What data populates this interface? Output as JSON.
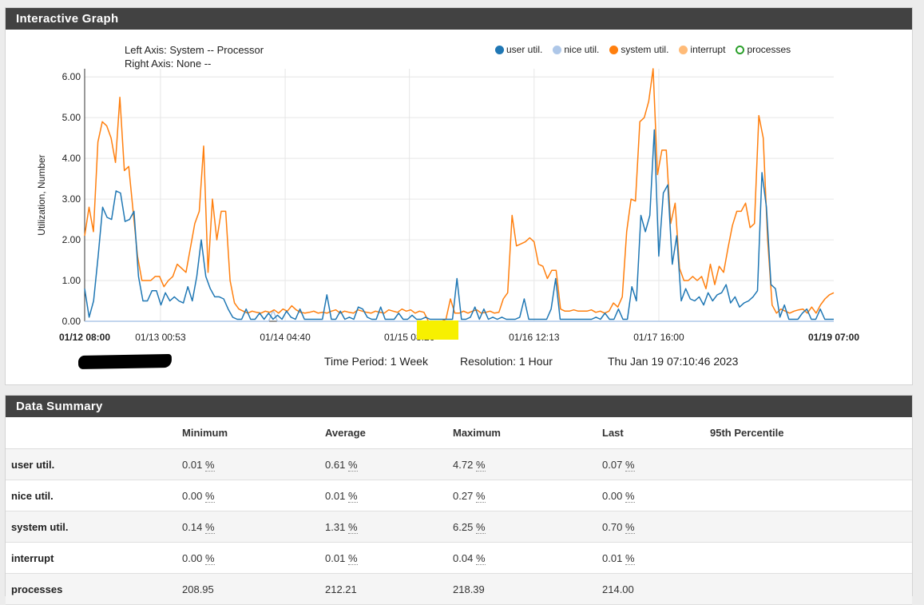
{
  "graph_panel": {
    "title": "Interactive Graph"
  },
  "graph_info": {
    "left_axis": "Left Axis: System -- Processor",
    "right_axis": "Right Axis: None --",
    "time_period": "Time Period: 1 Week",
    "resolution": "Resolution: 1 Hour",
    "timestamp": "Thu Jan 19 07:10:46 2023"
  },
  "legend": [
    {
      "label": "user util.",
      "color": "#1f77b4",
      "filled": true
    },
    {
      "label": "nice util.",
      "color": "#aec7e8",
      "filled": true
    },
    {
      "label": "system util.",
      "color": "#ff7f0e",
      "filled": true
    },
    {
      "label": "interrupt",
      "color": "#ffbb78",
      "filled": true
    },
    {
      "label": "processes",
      "color": "#2ca02c",
      "filled": false
    }
  ],
  "chart_data": {
    "type": "line",
    "ylabel": "Utilization, Number",
    "ylim": [
      0,
      6.2
    ],
    "y_ticks": [
      "0.00",
      "1.00",
      "2.00",
      "3.00",
      "4.00",
      "5.00",
      "6.00"
    ],
    "x_ticks": [
      {
        "label": "01/12 08:00",
        "hour": 0,
        "bold": true
      },
      {
        "label": "01/13 00:53",
        "hour": 16.9,
        "bold": false
      },
      {
        "label": "01/14 04:40",
        "hour": 44.7,
        "bold": false
      },
      {
        "label": "01/15 08:26",
        "hour": 72.4,
        "bold": false
      },
      {
        "label": "01/16 12:13",
        "hour": 100.2,
        "bold": false
      },
      {
        "label": "01/17 16:00",
        "hour": 128,
        "bold": false
      },
      {
        "label": "01/19 07:00",
        "hour": 167,
        "bold": true
      }
    ],
    "gridlines_x_hours": [
      16.9,
      44.7,
      72.4,
      100.2,
      128
    ],
    "x_range_hours": [
      0,
      167
    ],
    "series": [
      {
        "name": "system util.",
        "color": "#ff7f0e",
        "values": [
          2.1,
          2.8,
          2.2,
          4.4,
          4.9,
          4.8,
          4.5,
          3.9,
          5.5,
          3.7,
          3.8,
          2.7,
          1.6,
          1.0,
          1.0,
          1.0,
          1.1,
          1.1,
          0.85,
          1.0,
          1.1,
          1.4,
          1.3,
          1.2,
          1.8,
          2.4,
          2.7,
          4.3,
          1.2,
          3.0,
          2.0,
          2.7,
          2.7,
          1.0,
          0.45,
          0.3,
          0.25,
          0.2,
          0.25,
          0.22,
          0.2,
          0.25,
          0.22,
          0.28,
          0.2,
          0.3,
          0.25,
          0.38,
          0.28,
          0.22,
          0.2,
          0.22,
          0.25,
          0.2,
          0.22,
          0.2,
          0.25,
          0.28,
          0.2,
          0.25,
          0.22,
          0.2,
          0.28,
          0.25,
          0.22,
          0.2,
          0.25,
          0.22,
          0.2,
          0.28,
          0.25,
          0.22,
          0.3,
          0.25,
          0.28,
          0.2,
          0.25,
          0.22,
          0.0,
          0.0,
          0.0,
          0.0,
          0.05,
          0.55,
          0.2,
          0.2,
          0.25,
          0.2,
          0.25,
          0.28,
          0.2,
          0.22,
          0.25,
          0.2,
          0.22,
          0.55,
          0.7,
          2.6,
          1.85,
          1.9,
          1.95,
          2.05,
          1.95,
          1.4,
          1.35,
          1.05,
          1.25,
          1.25,
          0.3,
          0.25,
          0.25,
          0.28,
          0.25,
          0.25,
          0.25,
          0.28,
          0.22,
          0.25,
          0.2,
          0.25,
          0.45,
          0.35,
          0.6,
          2.2,
          3.0,
          2.95,
          4.9,
          5.0,
          5.4,
          6.2,
          3.6,
          4.2,
          4.2,
          2.4,
          2.9,
          1.3,
          1.0,
          1.0,
          1.1,
          1.0,
          1.1,
          0.8,
          1.4,
          0.9,
          1.35,
          1.2,
          1.8,
          2.35,
          2.7,
          2.7,
          2.9,
          2.3,
          2.4,
          5.05,
          4.5,
          2.0,
          0.4,
          0.2,
          0.3,
          0.25,
          0.2,
          0.25,
          0.28,
          0.3,
          0.2,
          0.35,
          0.2,
          0.4,
          0.55,
          0.65,
          0.7
        ]
      },
      {
        "name": "user util.",
        "color": "#1f77b4",
        "values": [
          0.8,
          0.1,
          0.5,
          1.6,
          2.8,
          2.55,
          2.5,
          3.2,
          3.15,
          2.45,
          2.5,
          2.7,
          1.1,
          0.5,
          0.5,
          0.75,
          0.75,
          0.4,
          0.7,
          0.5,
          0.6,
          0.5,
          0.45,
          0.85,
          0.5,
          1.1,
          2.0,
          1.1,
          0.8,
          0.6,
          0.6,
          0.55,
          0.3,
          0.1,
          0.05,
          0.05,
          0.3,
          0.05,
          0.05,
          0.2,
          0.05,
          0.2,
          0.05,
          0.15,
          0.05,
          0.25,
          0.1,
          0.05,
          0.3,
          0.05,
          0.05,
          0.05,
          0.05,
          0.05,
          0.65,
          0.05,
          0.05,
          0.25,
          0.05,
          0.1,
          0.05,
          0.35,
          0.3,
          0.1,
          0.05,
          0.05,
          0.35,
          0.05,
          0.05,
          0.05,
          0.2,
          0.05,
          0.05,
          0.15,
          0.05,
          0.05,
          0.1,
          0.05,
          0.05,
          0.05,
          0.05,
          0.05,
          0.05,
          1.05,
          0.05,
          0.05,
          0.1,
          0.35,
          0.05,
          0.3,
          0.05,
          0.1,
          0.05,
          0.1,
          0.05,
          0.05,
          0.05,
          0.1,
          0.55,
          0.05,
          0.05,
          0.05,
          0.05,
          0.05,
          0.3,
          1.05,
          0.05,
          0.05,
          0.05,
          0.05,
          0.05,
          0.05,
          0.05,
          0.05,
          0.1,
          0.05,
          0.2,
          0.05,
          0.05,
          0.3,
          0.05,
          0.05,
          0.85,
          0.5,
          2.6,
          2.2,
          2.6,
          4.7,
          1.6,
          3.15,
          3.35,
          1.4,
          2.1,
          0.5,
          0.8,
          0.55,
          0.5,
          0.6,
          0.4,
          0.7,
          0.5,
          0.65,
          0.7,
          0.9,
          0.45,
          0.6,
          0.35,
          0.45,
          0.5,
          0.6,
          0.75,
          3.65,
          2.8,
          0.9,
          0.8,
          0.1,
          0.4,
          0.05,
          0.05,
          0.05,
          0.2,
          0.3,
          0.05,
          0.05,
          0.3,
          0.05,
          0.05,
          0.05
        ]
      },
      {
        "name": "nice util.",
        "color": "#aec7e8",
        "values": [
          0.0,
          0.0,
          0.0,
          0.0,
          0.0,
          0.0,
          0.0,
          0.0,
          0.0,
          0.0,
          0.0,
          0.0,
          0.0,
          0.0,
          0.0,
          0.0,
          0.0,
          0.0,
          0.0,
          0.0,
          0.0,
          0.0,
          0.0,
          0.0,
          0.0,
          0.0,
          0.0,
          0.0,
          0.0,
          0.0,
          0.0,
          0.0,
          0.0,
          0.0,
          0.0,
          0.0,
          0.0,
          0.0,
          0.0,
          0.0,
          0.0,
          0.0,
          0.0,
          0.27,
          0.0,
          0.0,
          0.0,
          0.0,
          0.0,
          0.0,
          0.0,
          0.0,
          0.0,
          0.0,
          0.0,
          0.0,
          0.0,
          0.0,
          0.0,
          0.0,
          0.0,
          0.0,
          0.0,
          0.0,
          0.0,
          0.0,
          0.0,
          0.0,
          0.0,
          0.0,
          0.0,
          0.0,
          0.0,
          0.0,
          0.0,
          0.0,
          0.0,
          0.0,
          0.0,
          0.0,
          0.0,
          0.0,
          0.0,
          0.0,
          0.0,
          0.0,
          0.0,
          0.0,
          0.0,
          0.0,
          0.0,
          0.0,
          0.0,
          0.0,
          0.0,
          0.0,
          0.0,
          0.0,
          0.0,
          0.0,
          0.0,
          0.0,
          0.0,
          0.0,
          0.0,
          0.0,
          0.0,
          0.0,
          0.0,
          0.0,
          0.0,
          0.0,
          0.0,
          0.0,
          0.0,
          0.0,
          0.0,
          0.0,
          0.0,
          0.0,
          0.0,
          0.0,
          0.0,
          0.0,
          0.0,
          0.0,
          0.0,
          0.0,
          0.0,
          0.0,
          0.0,
          0.0,
          0.0,
          0.0,
          0.0,
          0.0,
          0.0,
          0.0,
          0.0,
          0.0,
          0.0,
          0.0,
          0.0,
          0.0,
          0.0,
          0.0,
          0.0,
          0.0,
          0.0,
          0.0,
          0.0,
          0.0,
          0.0,
          0.0,
          0.0,
          0.0,
          0.0,
          0.0,
          0.0,
          0.0,
          0.0,
          0.0,
          0.0,
          0.0,
          0.0,
          0.0,
          0.0,
          0.0,
          0.0,
          0.0,
          0.0,
          0.0
        ]
      }
    ]
  },
  "summary_panel": {
    "title": "Data Summary",
    "columns": [
      "",
      "Minimum",
      "Average",
      "Maximum",
      "Last",
      "95th Percentile"
    ],
    "rows": [
      {
        "label": "user util.",
        "min": "0.01",
        "avg": "0.61",
        "max": "4.72",
        "last": "0.07",
        "unit": "%"
      },
      {
        "label": "nice util.",
        "min": "0.00",
        "avg": "0.01",
        "max": "0.27",
        "last": "0.00",
        "unit": "%"
      },
      {
        "label": "system util.",
        "min": "0.14",
        "avg": "1.31",
        "max": "6.25",
        "last": "0.70",
        "unit": "%"
      },
      {
        "label": "interrupt",
        "min": "0.00",
        "avg": "0.01",
        "max": "0.04",
        "last": "0.01",
        "unit": "%"
      },
      {
        "label": "processes",
        "min": "208.95",
        "avg": "212.21",
        "max": "218.39",
        "last": "214.00",
        "unit": ""
      }
    ]
  }
}
